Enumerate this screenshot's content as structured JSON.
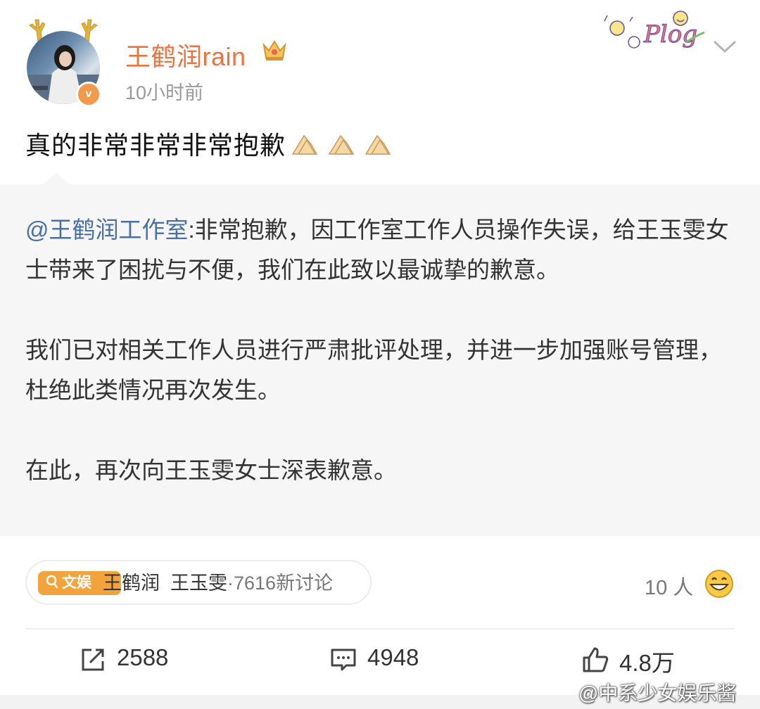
{
  "post": {
    "username": "王鹤润rain",
    "timestamp": "10小时前",
    "text": "真的非常非常非常抱歉",
    "badge_label": "Plog",
    "icons": {
      "crown": "crown-icon",
      "verified": "verified-badge-v",
      "menu": "chevron-down-icon",
      "text_emoji": "pressed-hands-emoji"
    }
  },
  "repost": {
    "mention": "@王鹤润工作室",
    "paragraphs": [
      ":非常抱歉，因工作室工作人员操作失误，给王玉雯女士带来了困扰与不便，我们在此致以最诚挚的歉意。",
      "我们已对相关工作人员进行严肃批评处理，并进一步加强账号管理，杜绝此类情况再次发生。",
      "在此，再次向王玉雯女士深表歉意。"
    ]
  },
  "topic": {
    "tag": "文娱",
    "names": "王鹤润  王玉雯",
    "count": "·7616新讨论"
  },
  "reactions": {
    "count_label": "10 人",
    "emoji": "grinning-face-emoji"
  },
  "actions": {
    "repost_count": "2588",
    "comment_count": "4948",
    "like_count": "4.8万"
  },
  "watermark": "@中系少女娱乐酱",
  "colors": {
    "username": "#eb7340",
    "mention": "#4a6fa5",
    "repost_bg": "#f6f6f6",
    "topic_tag": "#f3a33b",
    "verified": "#f2994a"
  }
}
